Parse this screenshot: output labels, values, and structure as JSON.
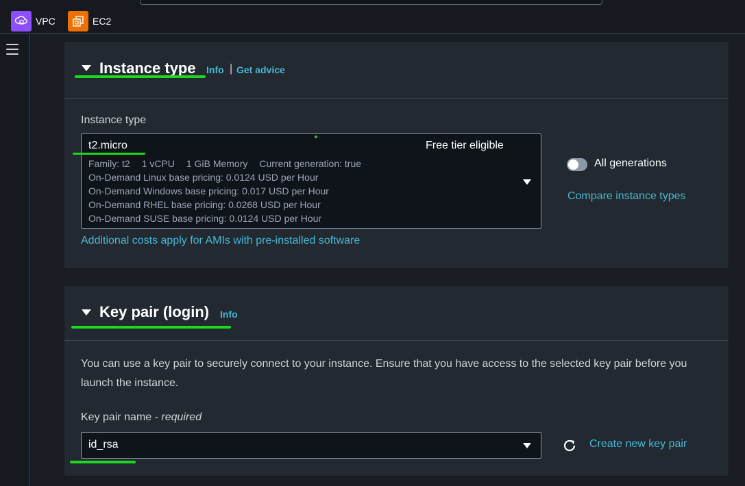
{
  "topbar": {
    "services": [
      {
        "label": "VPC",
        "icon": "vpc-icon",
        "color": "#8c4fff"
      },
      {
        "label": "EC2",
        "icon": "ec2-icon",
        "color": "#ed7100"
      }
    ]
  },
  "instance_type": {
    "section_title": "Instance type",
    "info_link": "Info",
    "separator": "|",
    "advice_link": "Get advice",
    "field_label": "Instance type",
    "selected": {
      "name": "t2.micro",
      "badge": "Free tier eligible",
      "family": "Family: t2",
      "vcpu": "1 vCPU",
      "memory": "1 GiB Memory",
      "generation": "Current generation: true",
      "pricing": [
        "On-Demand Linux base pricing: 0.0124 USD per Hour",
        "On-Demand Windows base pricing: 0.017 USD per Hour",
        "On-Demand RHEL base pricing: 0.0268 USD per Hour",
        "On-Demand SUSE base pricing: 0.0124 USD per Hour"
      ]
    },
    "all_generations_label": "All generations",
    "all_generations_on": false,
    "compare_link": "Compare instance types",
    "additional_costs_link": "Additional costs apply for AMIs with pre-installed software"
  },
  "key_pair": {
    "section_title": "Key pair (login)",
    "info_link": "Info",
    "description": "You can use a key pair to securely connect to your instance. Ensure that you have access to the selected key pair before you launch the instance.",
    "field_label": "Key pair name - ",
    "field_required": "required",
    "selected": "id_rsa",
    "create_link": "Create new key pair"
  },
  "colors": {
    "accent_link": "#44b9d6",
    "annotation_green": "#1ed81e"
  }
}
